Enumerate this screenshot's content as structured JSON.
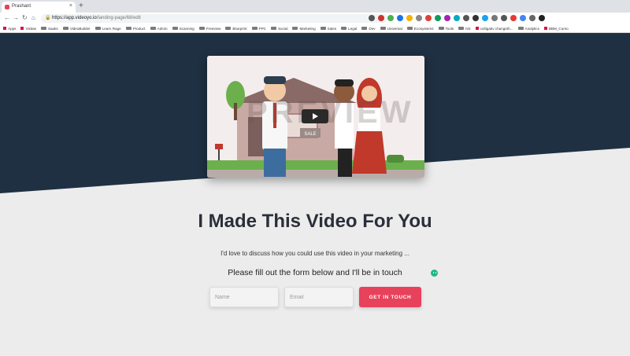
{
  "browser": {
    "tab_title": "Prashant",
    "tab_close": "×",
    "new_tab": "+",
    "url_host": "https://app.videoyo.io",
    "url_path": "/landing-page/68/edit",
    "nav": {
      "back": "←",
      "forward": "→",
      "reload": "↻",
      "home": "⌂"
    },
    "extension_colors": [
      "#555555",
      "#c33",
      "#4caf50",
      "#1a73e8",
      "#f4b400",
      "#888888",
      "#db4437",
      "#0f9d58",
      "#9c27b0",
      "#00acc1",
      "#555555",
      "#333333",
      "#1da1f2",
      "#777777",
      "#555555",
      "#e53935",
      "#4285f4",
      "#666666",
      "#212121"
    ]
  },
  "bookmarks": [
    {
      "label": "Apps",
      "icon": "apps"
    },
    {
      "label": "Visitas",
      "icon": "page"
    },
    {
      "label": "Saaks",
      "icon": "folder"
    },
    {
      "label": "VideoBuilder",
      "icon": "folder"
    },
    {
      "label": "Learn Rage",
      "icon": "folder"
    },
    {
      "label": "Product",
      "icon": "folder"
    },
    {
      "label": "Admin",
      "icon": "folder"
    },
    {
      "label": "Scanning",
      "icon": "folder"
    },
    {
      "label": "Freeview",
      "icon": "folder"
    },
    {
      "label": "Blueprint",
      "icon": "folder"
    },
    {
      "label": "PPC",
      "icon": "folder"
    },
    {
      "label": "Social",
      "icon": "folder"
    },
    {
      "label": "Marketing",
      "icon": "folder"
    },
    {
      "label": "Sales",
      "icon": "folder"
    },
    {
      "label": "Legal",
      "icon": "folder"
    },
    {
      "label": "Dev",
      "icon": "folder"
    },
    {
      "label": "Universal",
      "icon": "folder"
    },
    {
      "label": "Ecosystems",
      "icon": "folder"
    },
    {
      "label": "Tools",
      "icon": "folder"
    },
    {
      "label": "NS",
      "icon": "folder"
    },
    {
      "label": "cultigativ changeth...",
      "icon": "page"
    },
    {
      "label": "Analytics",
      "icon": "folder"
    },
    {
      "label": "BBM_Curso",
      "icon": "globe"
    }
  ],
  "page": {
    "video": {
      "watermark": "PREVIEW",
      "sign": "SALE",
      "play_icon": "play-icon"
    },
    "headline": "I Made This Video For You",
    "intro": "I'd love to discuss how you could use this video in your marketing ...",
    "subheading": "Please fill out the form below and I'll be in touch",
    "form": {
      "name_placeholder": "Name",
      "email_placeholder": "Email",
      "submit_label": "GET IN TOUCH"
    }
  },
  "colors": {
    "hero": "#1f3042",
    "page_bg": "#ececec",
    "accent": "#e8415b",
    "headline": "#2b2f3a"
  }
}
